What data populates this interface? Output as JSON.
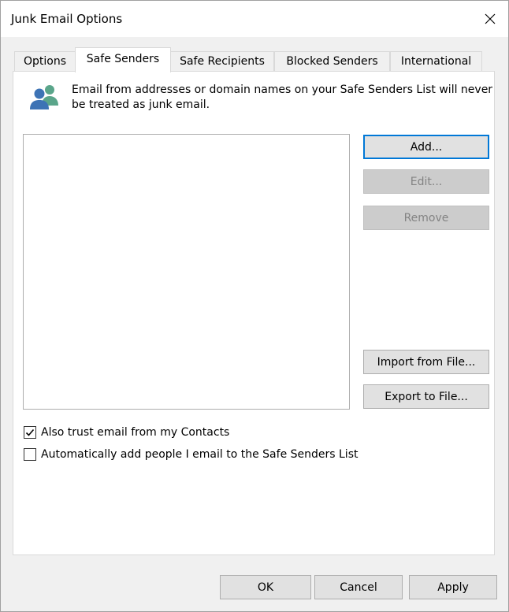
{
  "window": {
    "title": "Junk Email Options",
    "close_glyph": "✕"
  },
  "tabs": [
    {
      "label": "Options",
      "active": false
    },
    {
      "label": "Safe Senders",
      "active": true
    },
    {
      "label": "Safe Recipients",
      "active": false
    },
    {
      "label": "Blocked Senders",
      "active": false
    },
    {
      "label": "International",
      "active": false
    }
  ],
  "safe_senders": {
    "icon": "people-icon",
    "description": "Email from addresses or domain names on your Safe Senders List will never be treated as junk email.",
    "list_items": [],
    "buttons": {
      "add": "Add...",
      "edit": "Edit...",
      "remove": "Remove",
      "import": "Import from File...",
      "export": "Export to File..."
    },
    "checkboxes": [
      {
        "label": "Also trust email from my Contacts",
        "checked": true
      },
      {
        "label": "Automatically add people I email to the Safe Senders List",
        "checked": false
      }
    ]
  },
  "footer": {
    "ok": "OK",
    "cancel": "Cancel",
    "apply": "Apply"
  },
  "colors": {
    "accent": "#0078d7",
    "icon_blue": "#3d73b5",
    "icon_teal": "#5aa58a"
  }
}
